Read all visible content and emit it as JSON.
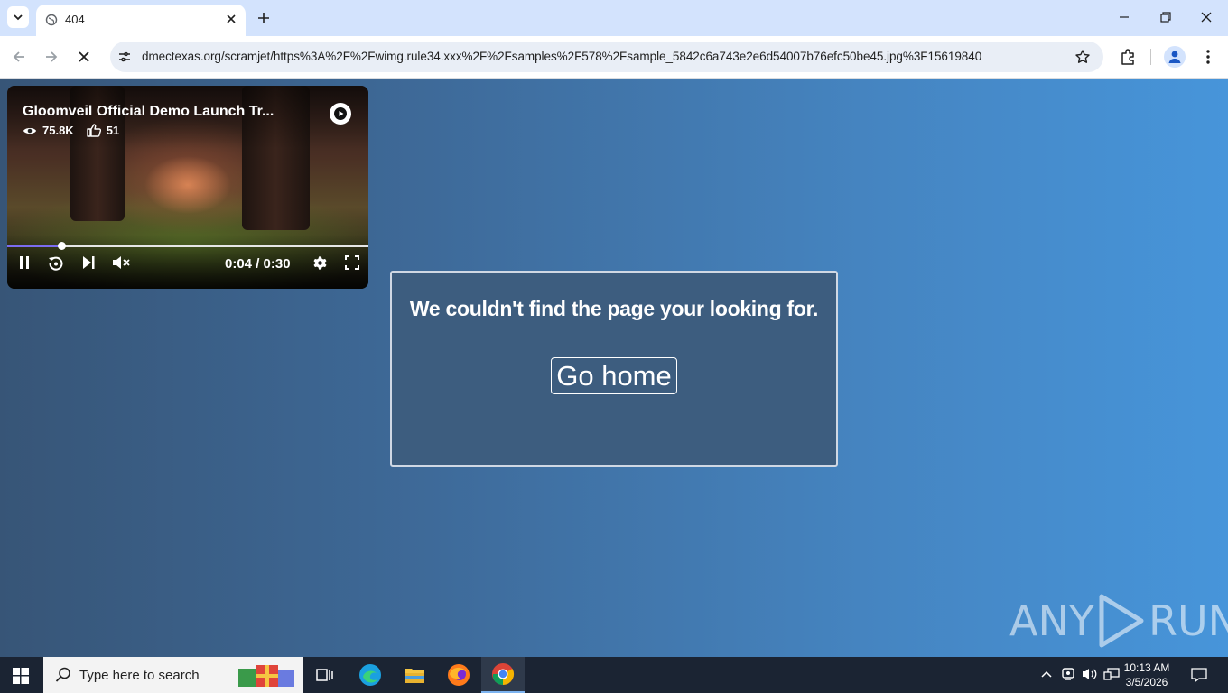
{
  "browser": {
    "tab": {
      "title": "404"
    },
    "url": "dmectexas.org/scramjet/https%3A%2F%2Fwimg.rule34.xxx%2F%2Fsamples%2F578%2Fsample_5842c6a743e2e6d54007b76efc50be45.jpg%3F15619840"
  },
  "video_player": {
    "title": "Gloomveil Official Demo Launch Tr...",
    "views": "75.8K",
    "likes": "51",
    "current_time": "0:04",
    "separator": "/",
    "duration": "0:30",
    "progress_fraction": 0.15
  },
  "not_found": {
    "message": "We couldn't find the page your looking for.",
    "home_button": "Go home"
  },
  "watermark": {
    "left": "ANY",
    "right": "RUN"
  },
  "taskbar": {
    "search_placeholder": "Type here to search",
    "time": "10:13 AM",
    "date": "3/5/2026"
  },
  "icons": [
    "tab-search-icon",
    "globe-icon",
    "close-icon",
    "plus-icon",
    "minimize-icon",
    "restore-icon",
    "window-close-icon",
    "back-arrow-icon",
    "forward-arrow-icon",
    "stop-loading-icon",
    "site-info-icon",
    "bookmark-star-icon",
    "extensions-icon",
    "profile-icon",
    "kebab-menu-icon",
    "eye-icon",
    "thumbs-up-icon",
    "play-brand-icon",
    "pause-icon",
    "replay-icon",
    "skip-next-icon",
    "mute-icon",
    "settings-icon",
    "fullscreen-icon",
    "windows-start-icon",
    "search-icon",
    "task-view-icon",
    "edge-icon",
    "file-explorer-icon",
    "firefox-icon",
    "chrome-icon",
    "chevron-up-icon",
    "webcam-icon",
    "volume-icon",
    "network-icon",
    "notification-icon"
  ],
  "colors": {
    "accent": "#7b6cf0",
    "page_left": "#375577",
    "page_right": "#4795da",
    "tab_strip": "#d3e3fd"
  }
}
